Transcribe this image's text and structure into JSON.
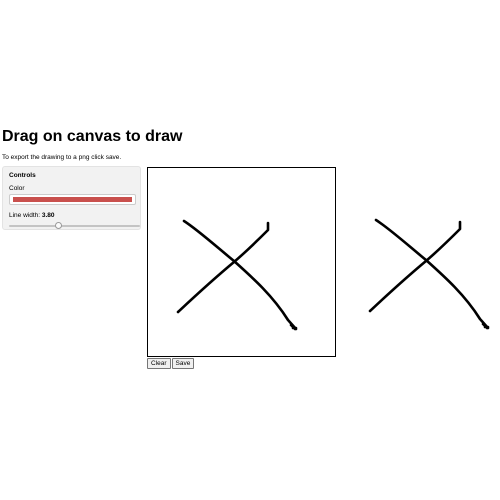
{
  "header": {
    "title": "Drag on canvas to draw",
    "instructions": "To export the drawing to a png click save."
  },
  "controls": {
    "heading": "Controls",
    "color_label": "Color",
    "color_value": "#c9504d",
    "line_width_label": "Line width:",
    "line_width_value": "3.80",
    "line_width_fraction": 0.38
  },
  "buttons": {
    "clear_label": "Clear",
    "save_label": "Save"
  },
  "drawing": {
    "stroke_color": "#000000"
  }
}
